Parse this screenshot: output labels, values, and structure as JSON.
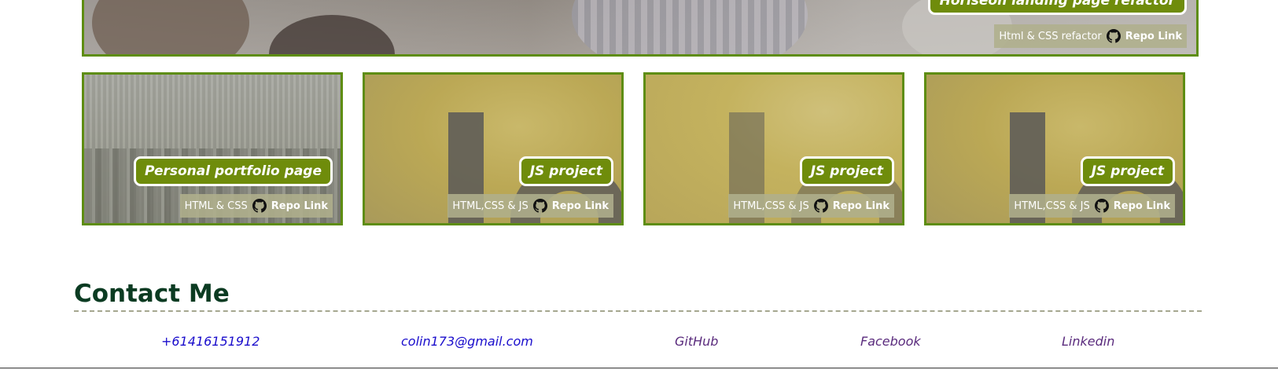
{
  "banner": {
    "title": "Horiseon landing page refactor",
    "tech": "Html & CSS refactor",
    "repo_label": "Repo Link"
  },
  "projects": [
    {
      "title": "Personal portfolio page",
      "tech": "HTML & CSS",
      "repo_label": "Repo Link"
    },
    {
      "title": "JS project",
      "tech": "HTML,CSS & JS",
      "repo_label": "Repo Link"
    },
    {
      "title": "JS project",
      "tech": "HTML,CSS & JS",
      "repo_label": "Repo Link"
    },
    {
      "title": "JS project",
      "tech": "HTML,CSS & JS",
      "repo_label": "Repo Link"
    }
  ],
  "contact": {
    "heading": "Contact Me",
    "links": [
      {
        "label": "+61416151912"
      },
      {
        "label": "colin173@gmail.com"
      },
      {
        "label": "GitHub"
      },
      {
        "label": "Facebook"
      },
      {
        "label": "Linkedin"
      }
    ]
  },
  "colors": {
    "accent_green": "#6f8c0b",
    "card_border": "#5e8d12",
    "heading": "#0b3b22",
    "link": "#1a0dcc",
    "link_visited": "#5a2b7d"
  },
  "icons": {
    "repo": "github-icon"
  }
}
